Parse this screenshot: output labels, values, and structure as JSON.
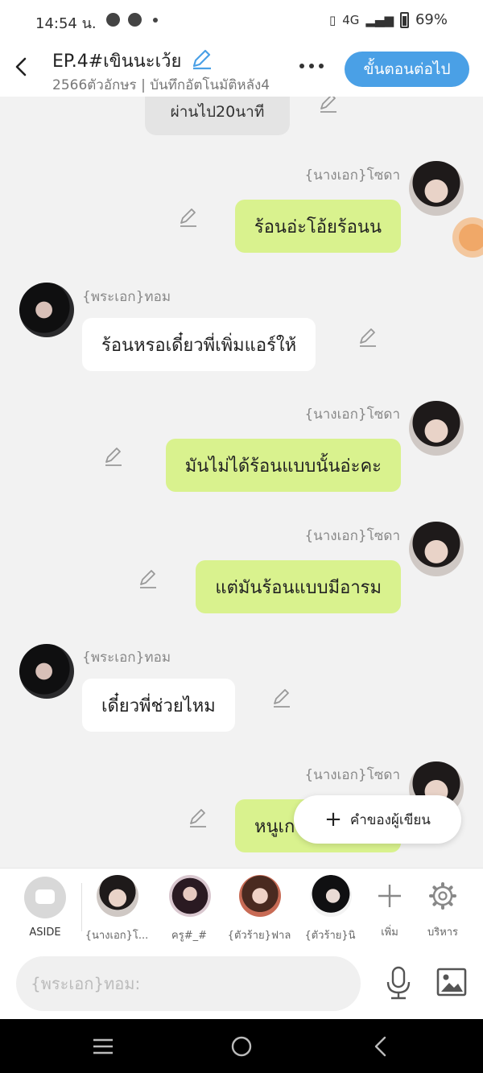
{
  "status_bar": {
    "time": "14:54 น.",
    "network": "4G",
    "battery": "69%"
  },
  "header": {
    "title": "EP.4#เขินนะเว้ย",
    "subtitle": "2566ตัวอักษร | บันทึกอัตโนมัติหลัง4",
    "next_button": "ขั้นตอนต่อไป"
  },
  "chat": {
    "system_message": "ผ่านไป20นาที",
    "messages": [
      {
        "side": "right",
        "name": "{นางเอก}โซดา",
        "text": "ร้อนอ่ะโอ้ยร้อนน",
        "avatar": "heroine"
      },
      {
        "side": "left",
        "name": "{พระเอก}ทอม",
        "text": "ร้อนหรอเดี๋ยวพี่เพิ่มแอร์ให้",
        "avatar": "hero"
      },
      {
        "side": "right",
        "name": "{นางเอก}โซดา",
        "text": "มันไม่ได้ร้อนแบบนั้นอ่ะคะ",
        "avatar": "heroine"
      },
      {
        "side": "right",
        "name": "{นางเอก}โซดา",
        "text": "แต่มันร้อนแบบมีอารม",
        "avatar": "heroine"
      },
      {
        "side": "left",
        "name": "{พระเอก}ทอม",
        "text": "เดี๋ยวพี่ช่วยไหม",
        "avatar": "hero"
      },
      {
        "side": "right",
        "name": "{นางเอก}โซดา",
        "text": "หนูเก",
        "avatar": "heroine"
      }
    ],
    "author_button": "คำของผู้เขียน"
  },
  "character_bar": {
    "aside_label": "ASIDE",
    "characters": [
      {
        "label": "{นางเอก}โ...",
        "avatar": "heroine"
      },
      {
        "label": "ครู#_#",
        "avatar": "teacher"
      },
      {
        "label": "{ตัวร้าย}ฟาล",
        "avatar": "villain1"
      },
      {
        "label": "{ตัวร้าย}นิ",
        "avatar": "villain2"
      }
    ],
    "add_label": "เพิ่ม",
    "admin_label": "บริหาร"
  },
  "input": {
    "placeholder": "{พระเอก}ทอม:"
  },
  "colors": {
    "accent": "#4aa0e6",
    "right_bubble": "#d9f28e",
    "left_bubble": "#ffffff"
  }
}
